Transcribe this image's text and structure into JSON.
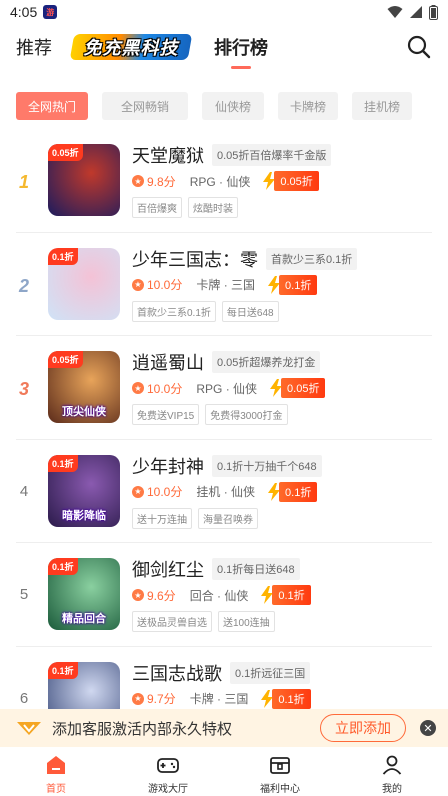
{
  "status_bar": {
    "time": "4:05"
  },
  "header": {
    "tab_recommend": "推荐",
    "brand": "免充黑科技",
    "tab_ranking": "排行榜"
  },
  "filters": [
    {
      "label": "全网热门",
      "active": true
    },
    {
      "label": "全网畅销",
      "active": false
    },
    {
      "label": "仙侠榜",
      "active": false
    },
    {
      "label": "卡牌榜",
      "active": false
    },
    {
      "label": "挂机榜",
      "active": false
    }
  ],
  "games": [
    {
      "rank": "1",
      "name": "天堂魔狱",
      "promo": "0.05折百倍爆率千金版",
      "score": "9.8分",
      "genre": "RPG · 仙侠",
      "discount": "0.05折",
      "tags": [
        "百倍爆爽",
        "炫酷时装"
      ],
      "icon_corner": "0.05折",
      "icon_caption": "",
      "icon_colors": [
        "#1b1b5e",
        "#c0392b"
      ]
    },
    {
      "rank": "2",
      "name": "少年三国志：零",
      "promo": "首款少三系0.1折",
      "score": "10.0分",
      "genre": "卡牌 · 三国",
      "discount": "0.1折",
      "tags": [
        "首款少三系0.1折",
        "每日送648"
      ],
      "icon_corner": "0.1折",
      "icon_caption": "",
      "icon_colors": [
        "#cfe3f7",
        "#f4c2d6"
      ]
    },
    {
      "rank": "3",
      "name": "逍遥蜀山",
      "promo": "0.05折超爆养龙打金",
      "score": "10.0分",
      "genre": "RPG · 仙侠",
      "discount": "0.05折",
      "tags": [
        "免费送VIP15",
        "免费得3000打金"
      ],
      "icon_corner": "0.05折",
      "icon_caption": "顶尖仙侠",
      "icon_colors": [
        "#5a2a1a",
        "#e8a45a"
      ]
    },
    {
      "rank": "4",
      "name": "少年封神",
      "promo": "0.1折十万抽千个648",
      "score": "10.0分",
      "genre": "挂机 · 仙侠",
      "discount": "0.1折",
      "tags": [
        "送十万连抽",
        "海量召唤券"
      ],
      "icon_corner": "0.1折",
      "icon_caption": "暗影降临",
      "icon_colors": [
        "#2a1a4a",
        "#8a5ab0"
      ]
    },
    {
      "rank": "5",
      "name": "御剑红尘",
      "promo": "0.1折每日送648",
      "score": "9.6分",
      "genre": "回合 · 仙侠",
      "discount": "0.1折",
      "tags": [
        "送极品灵兽自选",
        "送100连抽"
      ],
      "icon_corner": "0.1折",
      "icon_caption": "精品回合",
      "icon_colors": [
        "#1a5a3a",
        "#8ad0a0"
      ]
    },
    {
      "rank": "6",
      "name": "三国志战歌",
      "promo": "0.1折远征三国",
      "score": "9.7分",
      "genre": "卡牌 · 三国",
      "discount": "0.1折",
      "tags": [],
      "icon_corner": "0.1折",
      "icon_caption": "",
      "icon_colors": [
        "#3a4a7a",
        "#d0d8f0"
      ]
    }
  ],
  "banner": {
    "text": "添加客服激活内部永久特权",
    "button": "立即添加"
  },
  "nav": [
    {
      "label": "首页",
      "icon": "home-icon",
      "active": true
    },
    {
      "label": "游戏大厅",
      "icon": "gamepad-icon",
      "active": false
    },
    {
      "label": "福利中心",
      "icon": "gift-box-icon",
      "active": false
    },
    {
      "label": "我的",
      "icon": "user-icon",
      "active": false
    }
  ],
  "colors": {
    "accent": "#ff5a3a",
    "chip_active": "#ff7a6a",
    "gold": "#f5b82e",
    "silver": "#8ea6c8",
    "bronze": "#f07a5a"
  }
}
